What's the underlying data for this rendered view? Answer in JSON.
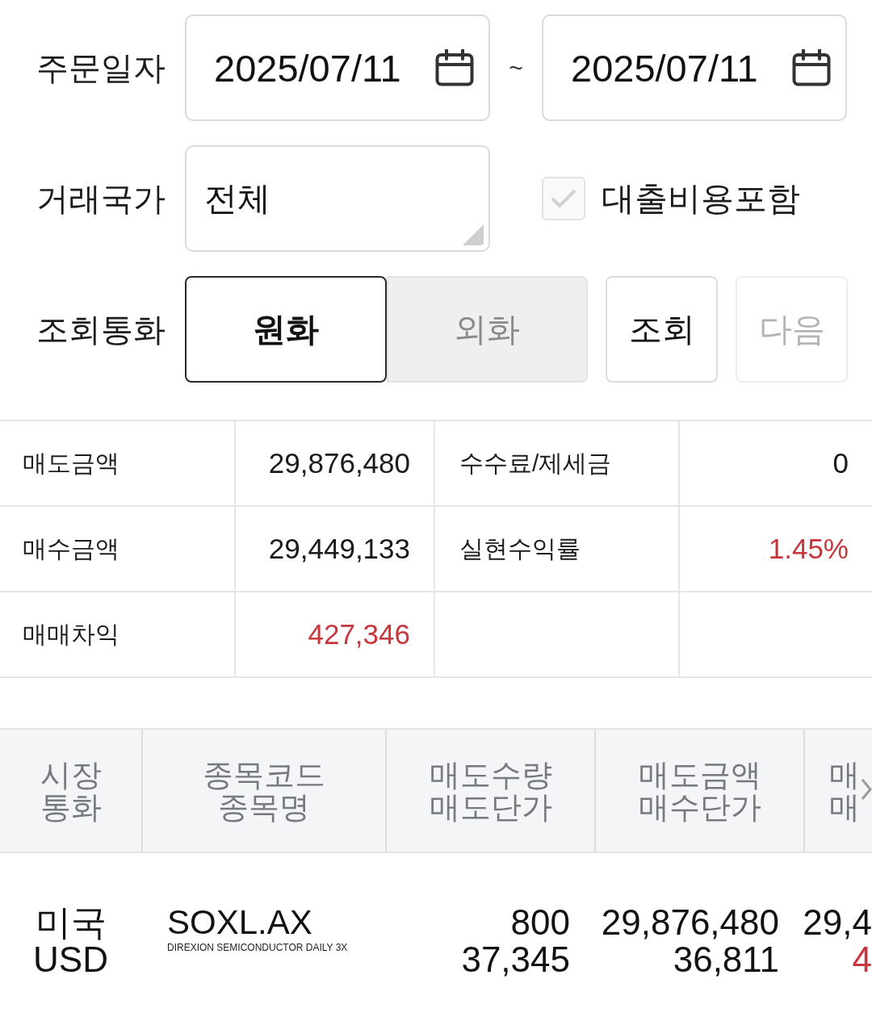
{
  "filters": {
    "order_date": {
      "label": "주문일자",
      "from": "2025/07/11",
      "separator": "~",
      "to": "2025/07/11"
    },
    "country": {
      "label": "거래국가",
      "value": "전체"
    },
    "include_loan_cost": {
      "label": "대출비용포함",
      "checked": true,
      "disabled": true
    },
    "currency": {
      "label": "조회통화",
      "options": [
        {
          "label": "원화",
          "selected": true
        },
        {
          "label": "외화",
          "selected": false
        }
      ]
    },
    "buttons": [
      {
        "label": "조회",
        "disabled": false
      },
      {
        "label": "다음",
        "disabled": true
      }
    ]
  },
  "summary": {
    "rows": [
      {
        "cells": [
          {
            "label": "매도금액",
            "value": "29,876,480",
            "rising": false
          },
          {
            "label": "수수료/제세금",
            "value": "0",
            "rising": false
          }
        ]
      },
      {
        "cells": [
          {
            "label": "매수금액",
            "value": "29,449,133",
            "rising": false
          },
          {
            "label": "실현수익률",
            "value": "1.45%",
            "rising": true
          }
        ]
      },
      {
        "cells": [
          {
            "label": "매매차익",
            "value": "427,346",
            "rising": true
          }
        ]
      }
    ]
  },
  "table": {
    "columns": [
      {
        "lines": [
          "시장",
          "통화"
        ]
      },
      {
        "lines": [
          "종목코드",
          "종목명"
        ]
      },
      {
        "lines": [
          "매도수량",
          "매도단가"
        ]
      },
      {
        "lines": [
          "매도금액",
          "매수단가"
        ]
      },
      {
        "lines": [
          "매",
          "매"
        ]
      }
    ],
    "rows": [
      {
        "market": "미국",
        "currency": "USD",
        "code": "SOXL.AX",
        "name": "DIREXION SEMICONDUCTOR DAILY 3X",
        "sell_quantity": "800",
        "sell_price": "37,345",
        "sell_amount": "29,876,480",
        "buy_price": "36,811",
        "column_5": [
          {
            "text": "29,4",
            "rising": false
          },
          {
            "text": "4",
            "rising": true
          }
        ]
      }
    ]
  }
}
